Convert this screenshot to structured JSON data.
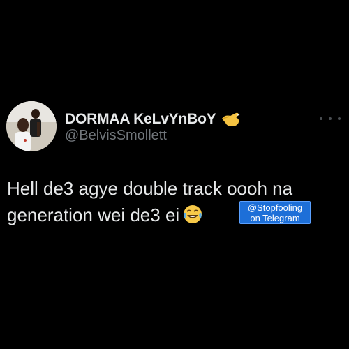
{
  "tweet": {
    "author": {
      "display_name": "DORMAA KeLvYnBoY",
      "name_emoji_icon": "saluting-hand-icon",
      "handle": "@BelvisSmollett",
      "avatar_icon": "profile-photo"
    },
    "more_icon": "more-options-icon",
    "text_lines": [
      "Hell de3 agye double track oooh na",
      "generation wei de3 ei"
    ],
    "trailing_emoji_icon": "tears-of-joy-icon"
  },
  "watermark": {
    "line1": "@Stopfooling",
    "line2": "on Telegram",
    "color": "#1d6fd8"
  },
  "colors": {
    "background": "#000000",
    "primary_text": "#e7e9ea",
    "secondary_text": "#71767b"
  }
}
